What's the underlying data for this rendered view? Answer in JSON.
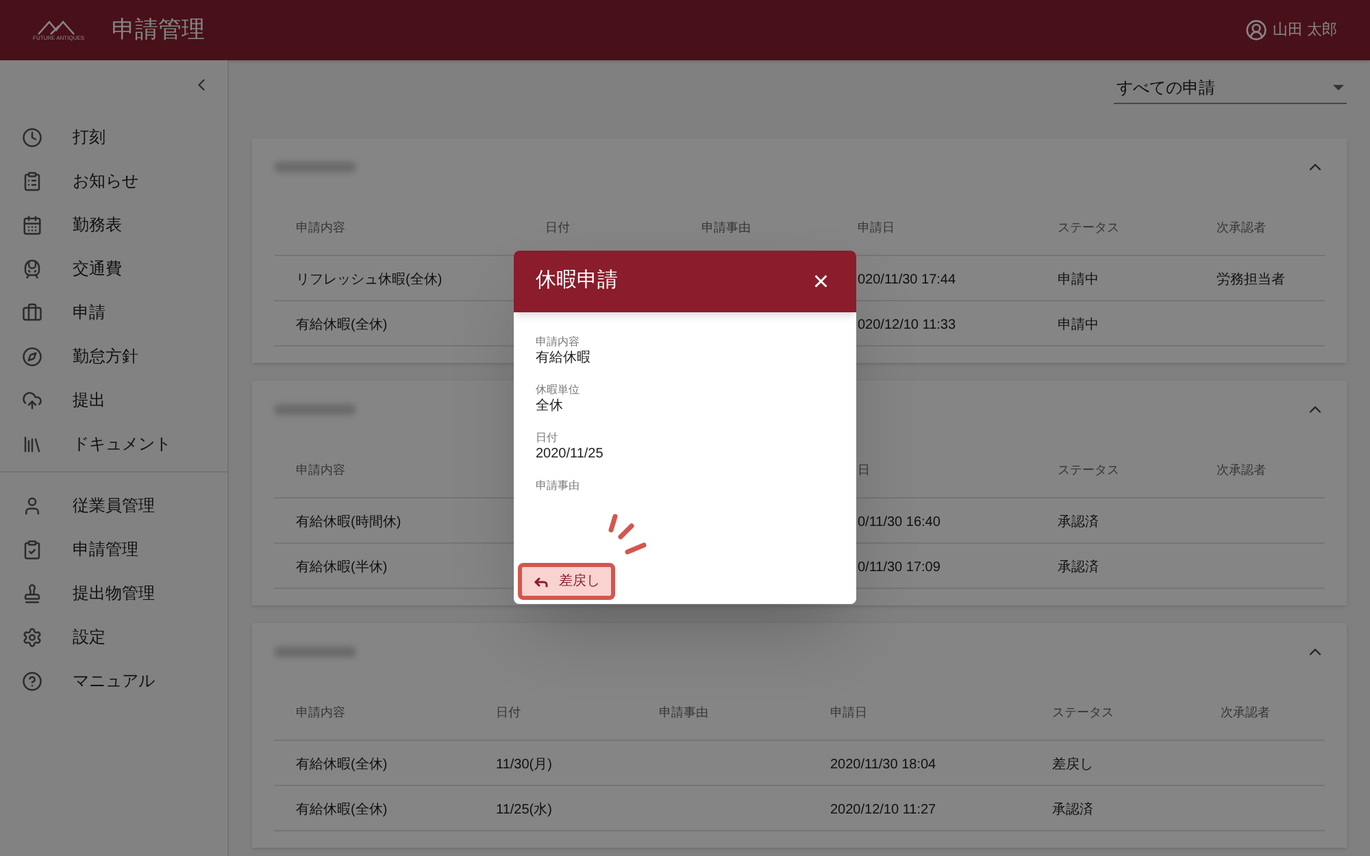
{
  "header": {
    "logo_text": "FUTURE ANTIQUES",
    "title": "申請管理",
    "user": "山田 太郎"
  },
  "sidebar": {
    "groups": [
      [
        {
          "label": "打刻"
        },
        {
          "label": "お知らせ"
        },
        {
          "label": "勤務表"
        },
        {
          "label": "交通費"
        },
        {
          "label": "申請"
        },
        {
          "label": "勤怠方針"
        },
        {
          "label": "提出"
        },
        {
          "label": "ドキュメント"
        }
      ],
      [
        {
          "label": "従業員管理"
        },
        {
          "label": "申請管理"
        },
        {
          "label": "提出物管理"
        },
        {
          "label": "設定"
        },
        {
          "label": "マニュアル"
        }
      ]
    ]
  },
  "filter": {
    "value": "すべての申請"
  },
  "cards": [
    {
      "columns": [
        "申請内容",
        "日付",
        "申請事由",
        "申請日",
        "ステータス",
        "次承認者"
      ],
      "rows": [
        {
          "cells": [
            "リフレッシュ休暇(全休)",
            null,
            null,
            "020/11/30 17:44",
            "申請中",
            "労務担当者"
          ]
        },
        {
          "cells": [
            "有給休暇(全休)",
            null,
            null,
            "020/12/10 11:33",
            "申請中",
            null
          ]
        }
      ]
    },
    {
      "columns": [
        "申請内容",
        null,
        null,
        "日",
        "ステータス",
        "次承認者"
      ],
      "rows": [
        {
          "cells": [
            "有給休暇(時間休)",
            null,
            null,
            "0/11/30 16:40",
            "承認済",
            null
          ]
        },
        {
          "cells": [
            "有給休暇(半休)",
            null,
            null,
            "0/11/30 17:09",
            "承認済",
            null
          ]
        }
      ]
    },
    {
      "columns": [
        "申請内容",
        "日付",
        "申請事由",
        "申請日",
        "ステータス",
        "次承認者"
      ],
      "rows": [
        {
          "cells": [
            "有給休暇(全休)",
            "11/30(月)",
            null,
            "2020/11/30 18:04",
            "差戻し",
            null
          ]
        },
        {
          "cells": [
            "有給休暇(全休)",
            "11/25(水)",
            null,
            "2020/12/10 11:27",
            "承認済",
            null
          ]
        }
      ]
    }
  ],
  "dialog": {
    "title": "休暇申請",
    "close": "×",
    "fields": [
      {
        "label": "申請内容",
        "value": "有給休暇"
      },
      {
        "label": "休暇単位",
        "value": "全休"
      },
      {
        "label": "日付",
        "value": "2020/11/25"
      },
      {
        "label": "申請事由"
      }
    ],
    "button": {
      "label": "差戻し",
      "highlighted": true
    }
  }
}
